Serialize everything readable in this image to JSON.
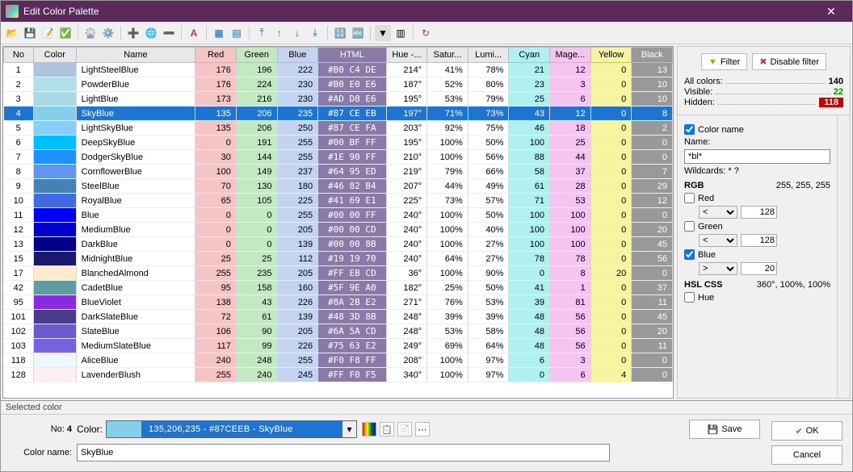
{
  "title": "Edit Color Palette",
  "columns": [
    "No",
    "Color",
    "Name",
    "Red",
    "Green",
    "Blue",
    "HTML",
    "Hue -...",
    "Satur...",
    "Lumi...",
    "Cyan",
    "Mage...",
    "Yellow",
    "Black"
  ],
  "selected_index": 3,
  "rows": [
    {
      "no": 1,
      "hex": "#B0C4DE",
      "name": "LightSteelBlue",
      "r": 176,
      "g": 196,
      "b": 222,
      "html": "#B0 C4 DE",
      "hue": "214°",
      "sat": "41%",
      "lum": "78%",
      "c": 21,
      "m": 12,
      "y": 0,
      "k": 13
    },
    {
      "no": 2,
      "hex": "#B0E0E6",
      "name": "PowderBlue",
      "r": 176,
      "g": 224,
      "b": 230,
      "html": "#B0 E0 E6",
      "hue": "187°",
      "sat": "52%",
      "lum": "80%",
      "c": 23,
      "m": 3,
      "y": 0,
      "k": 10
    },
    {
      "no": 3,
      "hex": "#ADD8E6",
      "name": "LightBlue",
      "r": 173,
      "g": 216,
      "b": 230,
      "html": "#AD D8 E6",
      "hue": "195°",
      "sat": "53%",
      "lum": "79%",
      "c": 25,
      "m": 6,
      "y": 0,
      "k": 10
    },
    {
      "no": 4,
      "hex": "#87CEEB",
      "name": "SkyBlue",
      "r": 135,
      "g": 206,
      "b": 235,
      "html": "#87 CE EB",
      "hue": "197°",
      "sat": "71%",
      "lum": "73%",
      "c": 43,
      "m": 12,
      "y": 0,
      "k": 8
    },
    {
      "no": 5,
      "hex": "#87CEFA",
      "name": "LightSkyBlue",
      "r": 135,
      "g": 206,
      "b": 250,
      "html": "#87 CE FA",
      "hue": "203°",
      "sat": "92%",
      "lum": "75%",
      "c": 46,
      "m": 18,
      "y": 0,
      "k": 2
    },
    {
      "no": 6,
      "hex": "#00BFFF",
      "name": "DeepSkyBlue",
      "r": 0,
      "g": 191,
      "b": 255,
      "html": "#00 BF FF",
      "hue": "195°",
      "sat": "100%",
      "lum": "50%",
      "c": 100,
      "m": 25,
      "y": 0,
      "k": 0
    },
    {
      "no": 7,
      "hex": "#1E90FF",
      "name": "DodgerSkyBlue",
      "r": 30,
      "g": 144,
      "b": 255,
      "html": "#1E 90 FF",
      "hue": "210°",
      "sat": "100%",
      "lum": "56%",
      "c": 88,
      "m": 44,
      "y": 0,
      "k": 0
    },
    {
      "no": 8,
      "hex": "#6495ED",
      "name": "CornflowerBlue",
      "r": 100,
      "g": 149,
      "b": 237,
      "html": "#64 95 ED",
      "hue": "219°",
      "sat": "79%",
      "lum": "66%",
      "c": 58,
      "m": 37,
      "y": 0,
      "k": 7
    },
    {
      "no": 9,
      "hex": "#4682B4",
      "name": "SteelBlue",
      "r": 70,
      "g": 130,
      "b": 180,
      "html": "#46 82 B4",
      "hue": "207°",
      "sat": "44%",
      "lum": "49%",
      "c": 61,
      "m": 28,
      "y": 0,
      "k": 29
    },
    {
      "no": 10,
      "hex": "#4169E1",
      "name": "RoyalBlue",
      "r": 65,
      "g": 105,
      "b": 225,
      "html": "#41 69 E1",
      "hue": "225°",
      "sat": "73%",
      "lum": "57%",
      "c": 71,
      "m": 53,
      "y": 0,
      "k": 12
    },
    {
      "no": 11,
      "hex": "#0000FF",
      "name": "Blue",
      "r": 0,
      "g": 0,
      "b": 255,
      "html": "#00 00 FF",
      "hue": "240°",
      "sat": "100%",
      "lum": "50%",
      "c": 100,
      "m": 100,
      "y": 0,
      "k": 0
    },
    {
      "no": 12,
      "hex": "#0000CD",
      "name": "MediumBlue",
      "r": 0,
      "g": 0,
      "b": 205,
      "html": "#00 00 CD",
      "hue": "240°",
      "sat": "100%",
      "lum": "40%",
      "c": 100,
      "m": 100,
      "y": 0,
      "k": 20
    },
    {
      "no": 13,
      "hex": "#00008B",
      "name": "DarkBlue",
      "r": 0,
      "g": 0,
      "b": 139,
      "html": "#00 00 8B",
      "hue": "240°",
      "sat": "100%",
      "lum": "27%",
      "c": 100,
      "m": 100,
      "y": 0,
      "k": 45
    },
    {
      "no": 15,
      "hex": "#191970",
      "name": "MidnightBlue",
      "r": 25,
      "g": 25,
      "b": 112,
      "html": "#19 19 70",
      "hue": "240°",
      "sat": "64%",
      "lum": "27%",
      "c": 78,
      "m": 78,
      "y": 0,
      "k": 56
    },
    {
      "no": 17,
      "hex": "#FFEBCD",
      "name": "BlanchedAlmond",
      "r": 255,
      "g": 235,
      "b": 205,
      "html": "#FF EB CD",
      "hue": "36°",
      "sat": "100%",
      "lum": "90%",
      "c": 0,
      "m": 8,
      "y": 20,
      "k": 0
    },
    {
      "no": 42,
      "hex": "#5F9EA0",
      "name": "CadetBlue",
      "r": 95,
      "g": 158,
      "b": 160,
      "html": "#5F 9E A0",
      "hue": "182°",
      "sat": "25%",
      "lum": "50%",
      "c": 41,
      "m": 1,
      "y": 0,
      "k": 37
    },
    {
      "no": 95,
      "hex": "#8A2BE2",
      "name": "BlueViolet",
      "r": 138,
      "g": 43,
      "b": 226,
      "html": "#8A 2B E2",
      "hue": "271°",
      "sat": "76%",
      "lum": "53%",
      "c": 39,
      "m": 81,
      "y": 0,
      "k": 11
    },
    {
      "no": 101,
      "hex": "#483D8B",
      "name": "DarkSlateBlue",
      "r": 72,
      "g": 61,
      "b": 139,
      "html": "#48 3D 8B",
      "hue": "248°",
      "sat": "39%",
      "lum": "39%",
      "c": 48,
      "m": 56,
      "y": 0,
      "k": 45
    },
    {
      "no": 102,
      "hex": "#6A5ACD",
      "name": "SlateBlue",
      "r": 106,
      "g": 90,
      "b": 205,
      "html": "#6A 5A CD",
      "hue": "248°",
      "sat": "53%",
      "lum": "58%",
      "c": 48,
      "m": 56,
      "y": 0,
      "k": 20
    },
    {
      "no": 103,
      "hex": "#7563E2",
      "name": "MediumSlateBlue",
      "r": 117,
      "g": 99,
      "b": 226,
      "html": "#75 63 E2",
      "hue": "249°",
      "sat": "69%",
      "lum": "64%",
      "c": 48,
      "m": 56,
      "y": 0,
      "k": 11
    },
    {
      "no": 118,
      "hex": "#F0F8FF",
      "name": "AliceBlue",
      "r": 240,
      "g": 248,
      "b": 255,
      "html": "#F0 F8 FF",
      "hue": "208°",
      "sat": "100%",
      "lum": "97%",
      "c": 6,
      "m": 3,
      "y": 0,
      "k": 0
    },
    {
      "no": 128,
      "hex": "#FFF0F5",
      "name": "LavenderBlush",
      "r": 255,
      "g": 240,
      "b": 245,
      "html": "#FF F0 F5",
      "hue": "340°",
      "sat": "100%",
      "lum": "97%",
      "c": 0,
      "m": 6,
      "y": 4,
      "k": 0
    }
  ],
  "side": {
    "filter_btn": "Filter",
    "disable_btn": "Disable filter",
    "all_label": "All colors:",
    "all_val": "140",
    "vis_label": "Visible:",
    "vis_val": "22",
    "hid_label": "Hidden:",
    "hid_val": "118",
    "colorname_chk": "Color name",
    "name_label": "Name:",
    "name_val": "*bl*",
    "wild": "Wildcards: * ?",
    "rgb_label": "RGB",
    "rgb_val": "255, 255, 255",
    "red": "Red",
    "green": "Green",
    "blue": "Blue",
    "rv": "128",
    "gv": "128",
    "bv": "20",
    "op_lt": "<",
    "op_gt": ">",
    "hsl_label": "HSL CSS",
    "hsl_val": "360°, 100%, 100%",
    "hue": "Hue"
  },
  "footer": {
    "sel_hdr": "Selected color",
    "no_label": "No:",
    "no_val": "4",
    "color_label": "Color:",
    "combo_text": "135,206,235 - #87CEEB - SkyBlue",
    "cname_label": "Color name:",
    "cname_val": "SkyBlue",
    "save": "Save",
    "ok": "OK",
    "cancel": "Cancel"
  }
}
